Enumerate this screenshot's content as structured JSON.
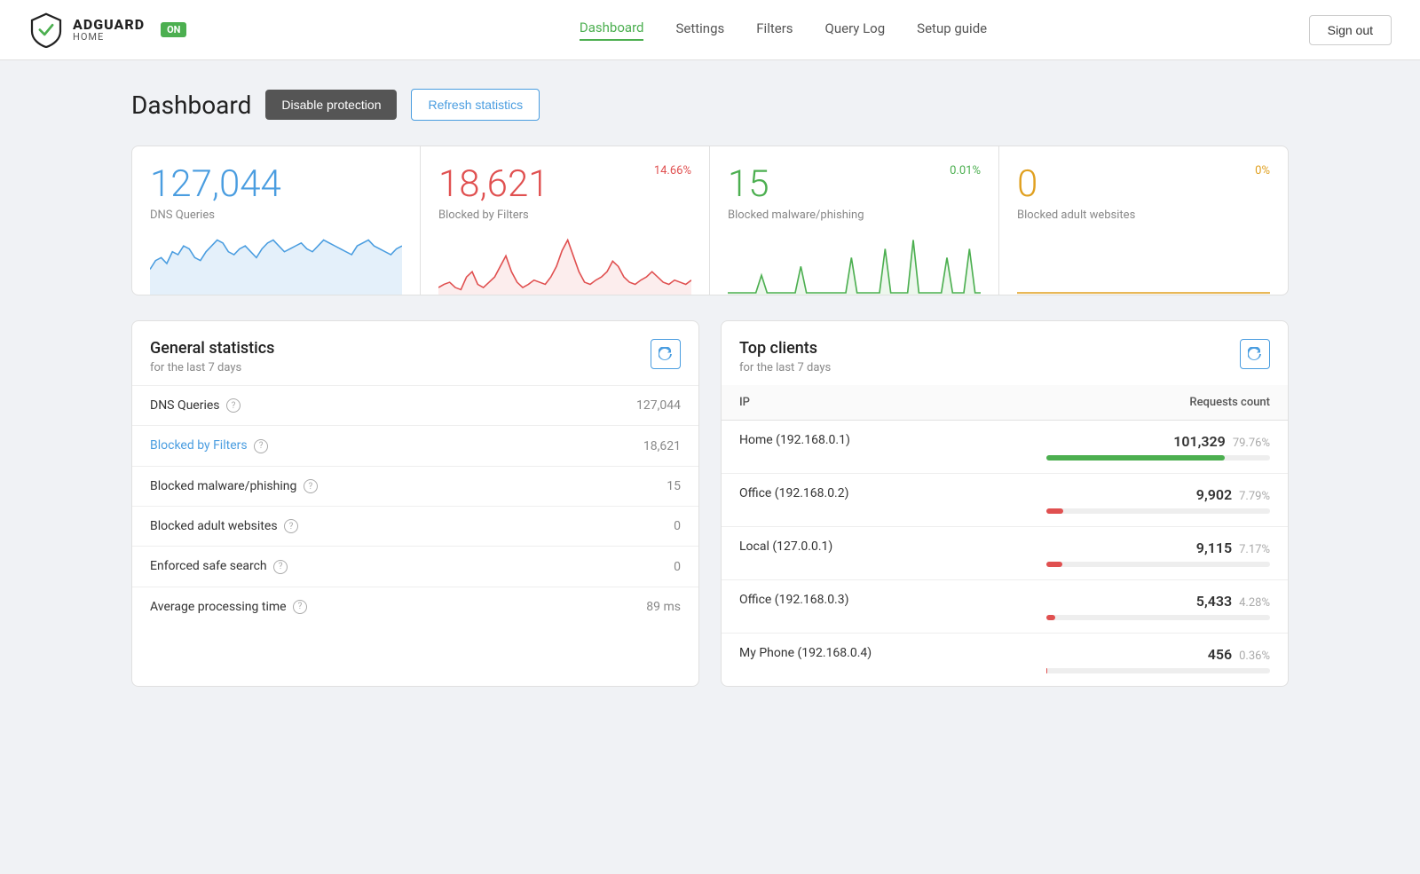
{
  "nav": {
    "logo_title": "ADGUARD",
    "logo_sub": "HOME",
    "badge": "ON",
    "links": [
      {
        "label": "Dashboard",
        "active": true
      },
      {
        "label": "Settings",
        "active": false
      },
      {
        "label": "Filters",
        "active": false
      },
      {
        "label": "Query Log",
        "active": false
      },
      {
        "label": "Setup guide",
        "active": false
      }
    ],
    "signout": "Sign out"
  },
  "page": {
    "title": "Dashboard",
    "btn_disable": "Disable protection",
    "btn_refresh": "Refresh statistics"
  },
  "stat_cards": [
    {
      "value": "127,044",
      "label": "DNS Queries",
      "percent": "",
      "color_class": "stat-blue",
      "pct_class": "",
      "chart_color": "#4a9de0",
      "chart_fill": "rgba(74,157,224,0.15)"
    },
    {
      "value": "18,621",
      "label": "Blocked by Filters",
      "percent": "14.66%",
      "color_class": "stat-red",
      "pct_class": "pct-red",
      "chart_color": "#e05050",
      "chart_fill": "rgba(224,80,80,0.1)"
    },
    {
      "value": "15",
      "label": "Blocked malware/phishing",
      "percent": "0.01%",
      "color_class": "stat-green",
      "pct_class": "pct-green",
      "chart_color": "#4caf50",
      "chart_fill": "rgba(76,175,80,0.1)"
    },
    {
      "value": "0",
      "label": "Blocked adult websites",
      "percent": "0%",
      "color_class": "stat-yellow",
      "pct_class": "pct-yellow",
      "chart_color": "#e0a020",
      "chart_fill": "rgba(224,160,32,0.1)"
    }
  ],
  "general_stats": {
    "title": "General statistics",
    "subtitle": "for the last 7 days",
    "rows": [
      {
        "label": "DNS Queries",
        "value": "127,044",
        "link": false
      },
      {
        "label": "Blocked by Filters",
        "value": "18,621",
        "link": true
      },
      {
        "label": "Blocked malware/phishing",
        "value": "15",
        "link": false
      },
      {
        "label": "Blocked adult websites",
        "value": "0",
        "link": false
      },
      {
        "label": "Enforced safe search",
        "value": "0",
        "link": false
      },
      {
        "label": "Average processing time",
        "value": "89 ms",
        "link": false
      }
    ]
  },
  "top_clients": {
    "title": "Top clients",
    "subtitle": "for the last 7 days",
    "col_ip": "IP",
    "col_requests": "Requests count",
    "rows": [
      {
        "name": "Home (192.168.0.1)",
        "count": "101,329",
        "pct": "79.76%",
        "bar_width": 79.76,
        "bar_class": "bar-green"
      },
      {
        "name": "Office (192.168.0.2)",
        "count": "9,902",
        "pct": "7.79%",
        "bar_width": 7.79,
        "bar_class": "bar-red"
      },
      {
        "name": "Local (127.0.0.1)",
        "count": "9,115",
        "pct": "7.17%",
        "bar_width": 7.17,
        "bar_class": "bar-red"
      },
      {
        "name": "Office (192.168.0.3)",
        "count": "5,433",
        "pct": "4.28%",
        "bar_width": 4.28,
        "bar_class": "bar-red"
      },
      {
        "name": "My Phone (192.168.0.4)",
        "count": "456",
        "pct": "0.36%",
        "bar_width": 0.36,
        "bar_class": "bar-red"
      }
    ]
  }
}
